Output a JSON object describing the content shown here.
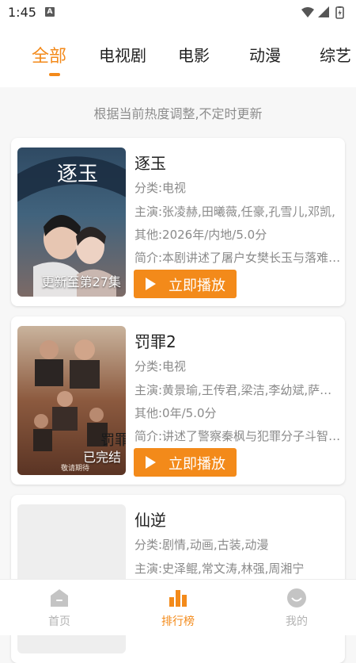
{
  "status_bar": {
    "time": "1:45",
    "notification_badge": "A"
  },
  "tabs": [
    {
      "label": "全部",
      "active": true
    },
    {
      "label": "电视剧",
      "active": false
    },
    {
      "label": "电影",
      "active": false
    },
    {
      "label": "动漫",
      "active": false
    },
    {
      "label": "综艺",
      "active": false
    }
  ],
  "hint": "根据当前热度调整,不定时更新",
  "items": [
    {
      "title": "逐玉",
      "category": "分类:电视",
      "cast": "主演:张凌赫,田曦薇,任豪,孔雪儿,邓凯,",
      "other": "其他:2026年/内地/5.0分",
      "summary": "简介:本剧讲述了屠户女樊长玉与落难侯爷",
      "poster_caption": "更新至第27集",
      "poster_title_art": "逐玉",
      "play_label": "立即播放"
    },
    {
      "title": "罚罪2",
      "category": "分类:电视",
      "cast": "主演:黄景瑜,王传君,梁洁,李幼斌,萨日娜",
      "other": "其他:0年/5.0分",
      "summary": "简介:讲述了警察秦枫与犯罪分子斗智斗勇",
      "poster_caption": "已完结",
      "poster_title_art": "罚罪",
      "poster_tagline": "敬请期待",
      "play_label": "立即播放"
    },
    {
      "title": "仙逆",
      "category": "分类:剧情,动画,古装,动漫",
      "cast": "主演:史泽鲲,常文涛,林强,周湘宁"
    }
  ],
  "bottom_nav": [
    {
      "label": "首页",
      "icon": "home-icon",
      "active": false
    },
    {
      "label": "排行榜",
      "icon": "ranking-icon",
      "active": true
    },
    {
      "label": "我的",
      "icon": "profile-icon",
      "active": false
    }
  ],
  "colors": {
    "accent": "#f38a1a",
    "muted": "#8a8a8a",
    "background": "#f7f7f7"
  }
}
